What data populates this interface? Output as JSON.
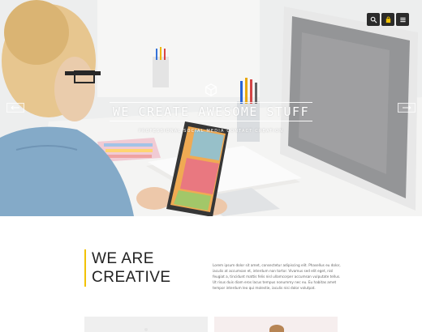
{
  "header": {
    "icons": [
      "search-icon",
      "bag-icon",
      "menu-icon"
    ]
  },
  "hero": {
    "title": "WE CREATE AWESOME STUFF",
    "subtitle": "PROFESSIONAL SOCIAL MEDIA CONTACT CREATION"
  },
  "intro": {
    "heading_line1": "WE ARE",
    "heading_line2": "CREATIVE",
    "paragraph": "Lorem ipsum dolor sit amet, consectetur adipiscing elit. Phasellus eu dolor, iaculis at accumsan et, interdum non tortor. Vivamus sed elit eget, nisl feugiat a, tincidunt mattis felis nisl ullamcorper accumsan vulputate tellus. Ut risus duis diam eros lacus tempus nonummy nec eu. Eu habitas amet tempor interdum leo qui molestie, iaculis nisi dolor volutpat."
  },
  "colors": {
    "accent": "#f2c200",
    "icon_bg": "#2b2b2b"
  }
}
